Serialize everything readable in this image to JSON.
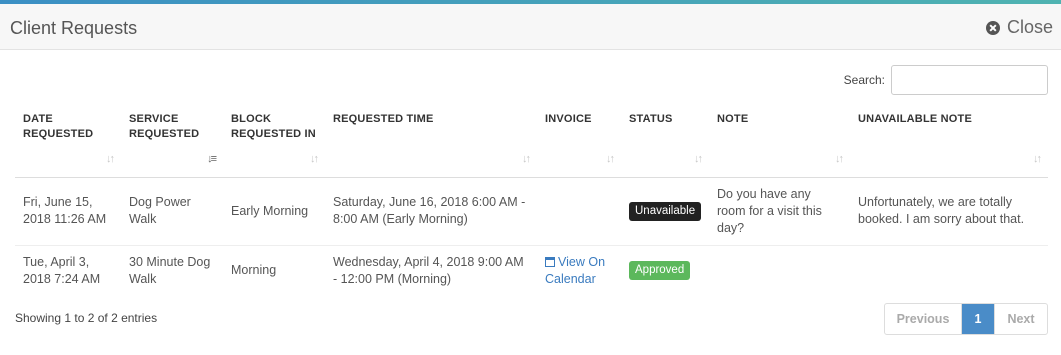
{
  "header": {
    "title": "Client Requests",
    "close_label": "Close"
  },
  "search": {
    "label": "Search:",
    "value": "",
    "placeholder": ""
  },
  "table": {
    "columns": [
      "DATE REQUESTED",
      "SERVICE REQUESTED",
      "BLOCK REQUESTED IN",
      "REQUESTED TIME",
      "INVOICE",
      "STATUS",
      "NOTE",
      "UNAVAILABLE NOTE"
    ],
    "rows": [
      {
        "date_requested": "Fri, June 15, 2018 11:26 AM",
        "service_requested": "Dog Power Walk",
        "block_requested_in": "Early Morning",
        "requested_time": "Saturday, June 16, 2018 6:00 AM - 8:00 AM (Early Morning)",
        "invoice": "",
        "status": "Unavailable",
        "note": "Do you have any room for a visit this day?",
        "unavailable_note": "Unfortunately, we are totally booked. I am sorry about that."
      },
      {
        "date_requested": "Tue, April 3, 2018 7:24 AM",
        "service_requested": "30 Minute Dog Walk",
        "block_requested_in": "Morning",
        "requested_time": "Wednesday, April 4, 2018 9:00 AM - 12:00 PM (Morning)",
        "invoice": "View On Calendar",
        "status": "Approved",
        "note": "",
        "unavailable_note": ""
      }
    ]
  },
  "footer": {
    "info": "Showing 1 to 2 of 2 entries",
    "previous_label": "Previous",
    "current_page": "1",
    "next_label": "Next"
  },
  "colors": {
    "status_unavailable": "#222222",
    "status_approved": "#5cb85c",
    "link": "#3a7bbf",
    "pager_active": "#4a8cc8"
  },
  "icons": {
    "close": "close-circle-icon",
    "sort": "sort-arrows-icon",
    "calendar": "calendar-icon"
  }
}
